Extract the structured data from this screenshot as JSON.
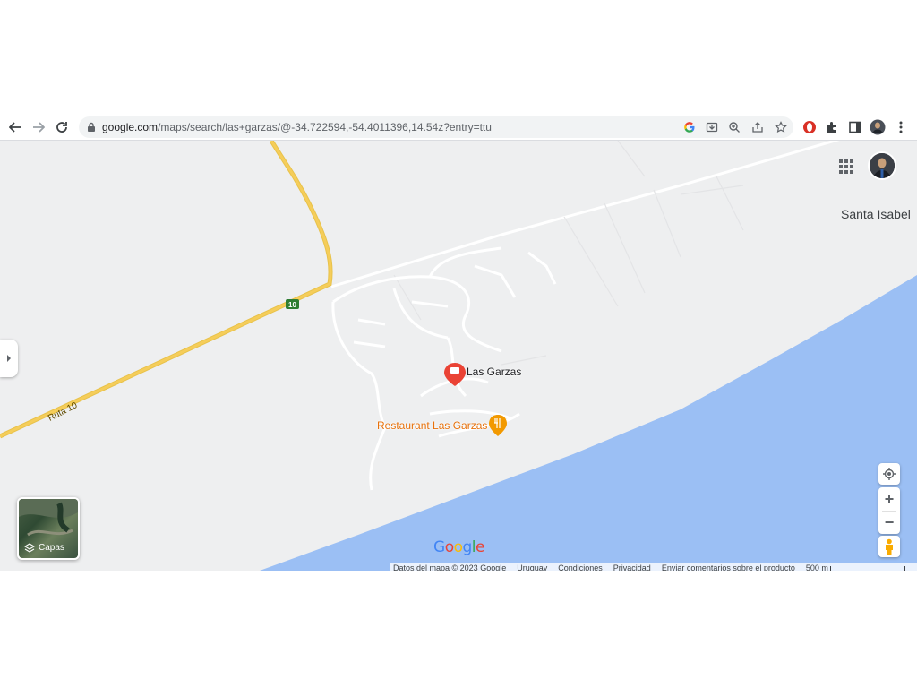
{
  "browser": {
    "url_host": "google.com",
    "url_path": "/maps/search/las+garzas/@-34.722594,-54.4011396,14.54z?entry=ttu",
    "extension_color": "#d93025"
  },
  "map": {
    "place_label": "Las Garzas",
    "restaurant_label": "Restaurant Las Garzas",
    "town_label": "Santa Isabel",
    "road_name": "Ruta 10",
    "road_shield": "10",
    "layers_label": "Capas",
    "zoom_in": "+",
    "zoom_out": "−",
    "logo": "Google",
    "colors": {
      "land": "#eeeff0",
      "water": "#9bbff4",
      "highway": "#f5cd5a",
      "pin": "#ea4335",
      "restaurant": "#e8710a"
    }
  },
  "footer": {
    "data": "Datos del mapa © 2023 Google",
    "country": "Uruguay",
    "terms": "Condiciones",
    "privacy": "Privacidad",
    "feedback": "Enviar comentarios sobre el producto",
    "scale": "500 m"
  }
}
